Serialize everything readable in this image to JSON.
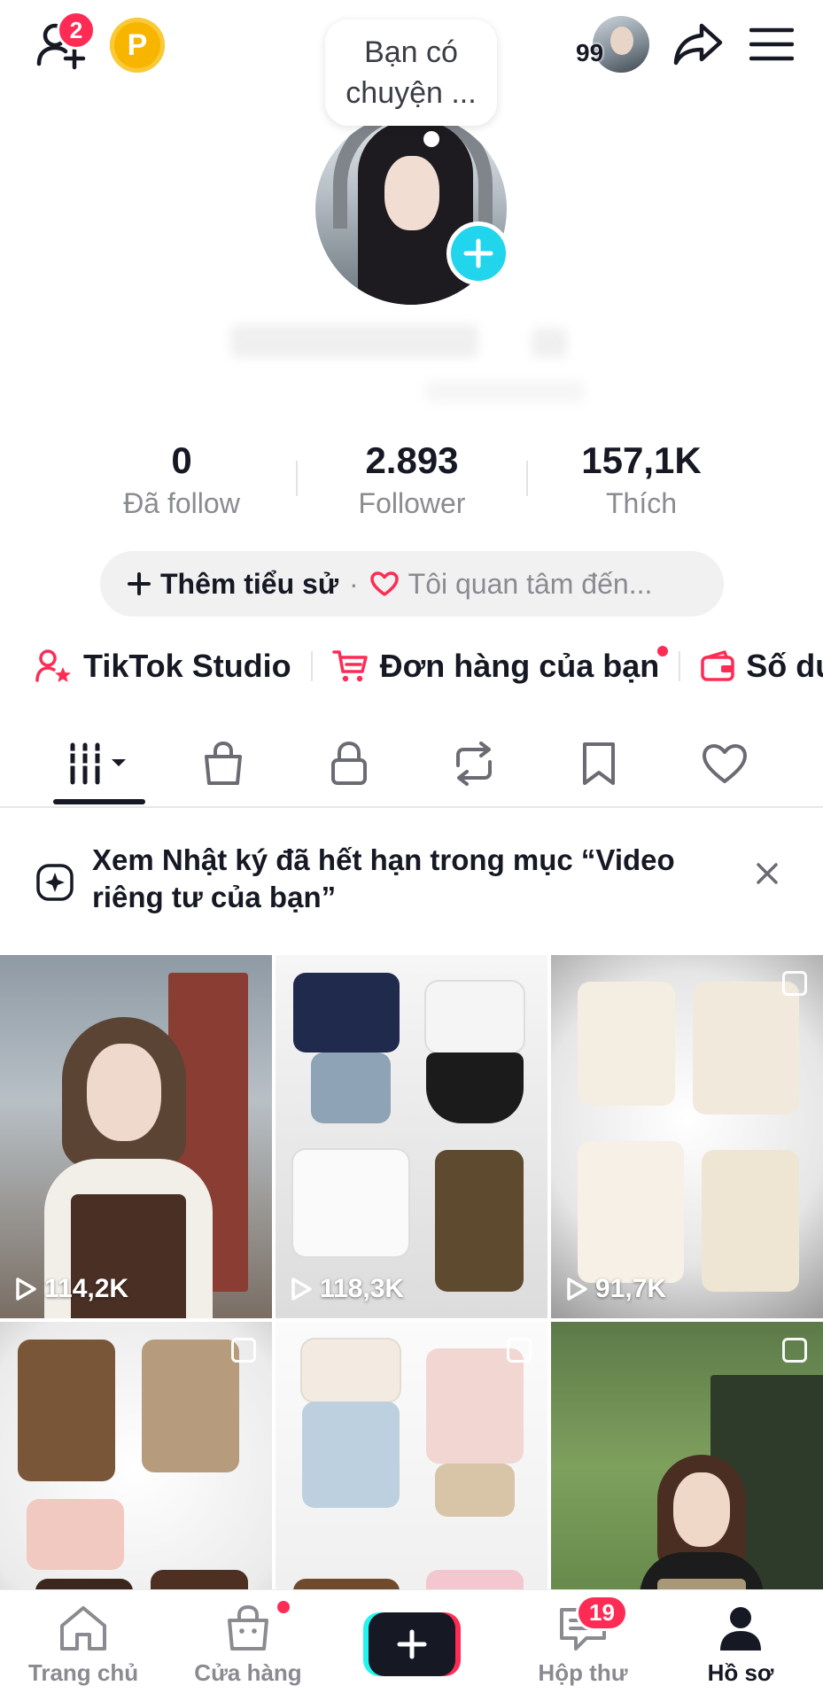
{
  "header": {
    "friend_requests_count": "2",
    "coin_label": "P",
    "mini_avatar_count": "99",
    "note_text": "Bạn có chuyện ..."
  },
  "stats": [
    {
      "value": "0",
      "label": "Đã follow"
    },
    {
      "value": "2.893",
      "label": "Follower"
    },
    {
      "value": "157,1K",
      "label": "Thích"
    }
  ],
  "bio": {
    "add_label": "Thêm tiểu sử",
    "separator": "·",
    "interests_label": "Tôi quan tâm đến..."
  },
  "quick_links": {
    "studio": "TikTok Studio",
    "orders": "Đơn hàng của bạn",
    "balance": "Số dư"
  },
  "banner": {
    "text": "Xem Nhật ký đã hết hạn trong mục “Video riêng tư của bạn”"
  },
  "videos": [
    {
      "views": "114,2K"
    },
    {
      "views": "118,3K"
    },
    {
      "views": "91,7K"
    },
    {
      "views": ""
    },
    {
      "views": ""
    },
    {
      "views": ""
    }
  ],
  "bottom_nav": {
    "home": "Trang chủ",
    "shop": "Cửa hàng",
    "inbox": "Hộp thư",
    "inbox_count": "19",
    "profile": "Hồ sơ"
  },
  "colors": {
    "accent_red": "#fe2c55",
    "accent_cyan": "#25f4ee",
    "avatar_plus": "#20d5ec",
    "coin": "#f7b500"
  }
}
